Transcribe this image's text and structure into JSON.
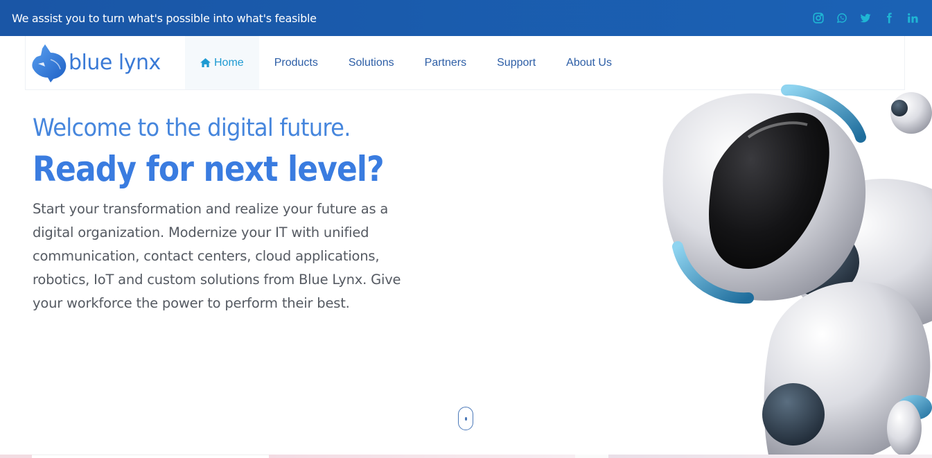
{
  "topbar": {
    "tagline": "We assist you to turn what's possible into what's feasible",
    "social": [
      "instagram-icon",
      "whatsapp-icon",
      "twitter-icon",
      "facebook-icon",
      "linkedin-icon"
    ],
    "color": "#1fb5d4"
  },
  "brand": {
    "name": "blue lynx"
  },
  "nav": {
    "home": "Home",
    "products": "Products",
    "solutions": "Solutions",
    "partners": "Partners",
    "support": "Support",
    "about": "About Us"
  },
  "hero": {
    "welcome": "Welcome to the digital future.",
    "headline": "Ready for next level?",
    "description": "Start your transformation and realize your future as a digital organization. Modernize your IT with unified communication, contact centers, cloud applications, robotics, IoT and custom solutions from Blue Lynx. Give your workforce the power to perform their best."
  },
  "colors": {
    "accent": "#3a7ce0",
    "topbar": "#1a56a6"
  }
}
